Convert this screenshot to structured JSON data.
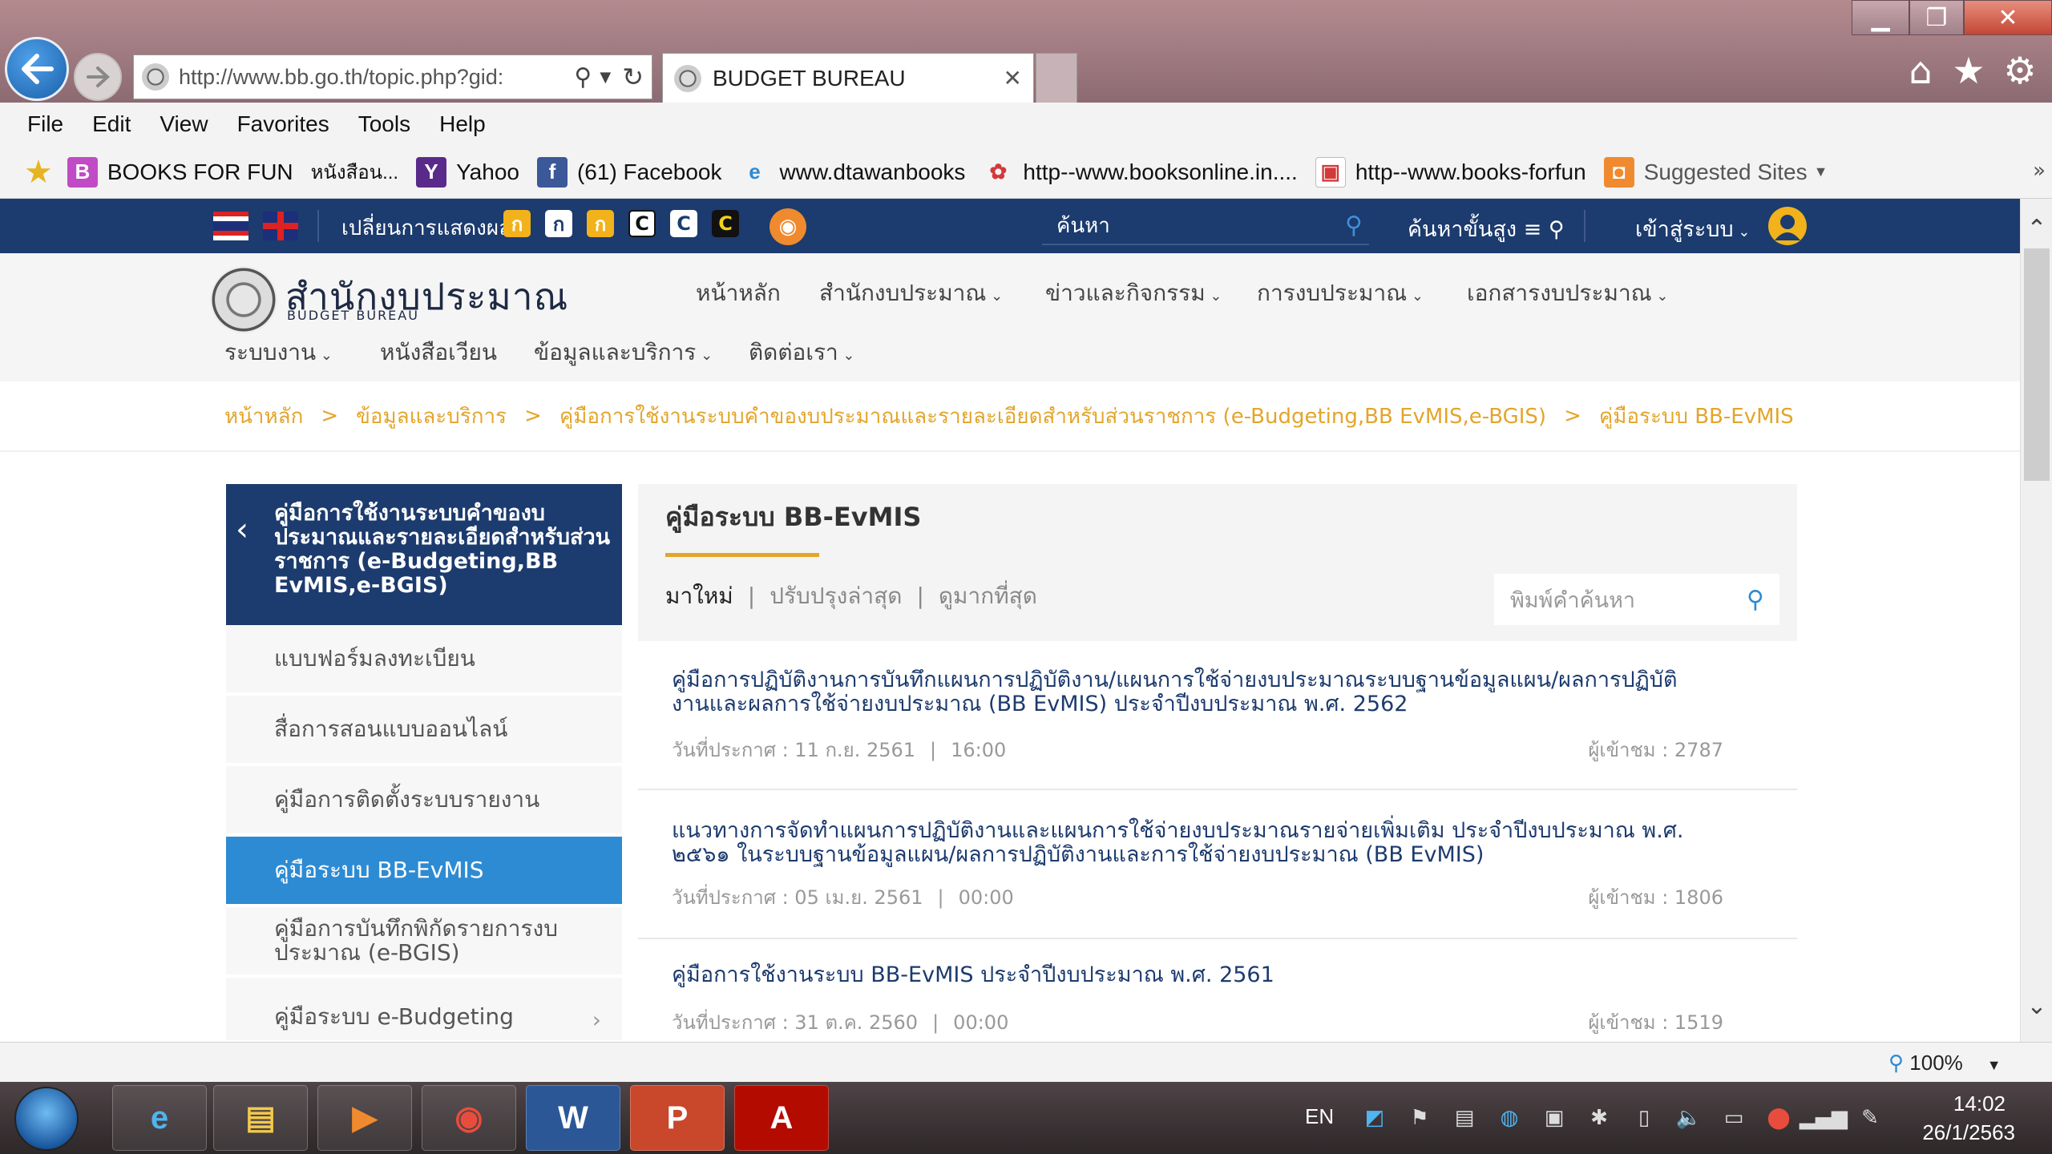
{
  "browser": {
    "url": "http://www.bb.go.th/topic.php?gid:",
    "tab_title": "BUDGET BUREAU",
    "menu": [
      "File",
      "Edit",
      "View",
      "Favorites",
      "Tools",
      "Help"
    ],
    "favorites": [
      {
        "label": "BOOKS FOR FUN",
        "icon": "B"
      },
      {
        "label": "หนังสือน...",
        "icon": ""
      },
      {
        "label": "Yahoo",
        "icon": "Y"
      },
      {
        "label": "(61) Facebook",
        "icon": "f"
      },
      {
        "label": "www.dtawanbooks",
        "icon": "e"
      },
      {
        "label": "http--www.booksonline.in....",
        "icon": "✿"
      },
      {
        "label": "http--www.books-forfun",
        "icon": "▣"
      },
      {
        "label": "Suggested Sites",
        "icon": "◘"
      }
    ],
    "zoom": "100%"
  },
  "site": {
    "topbar": {
      "display_label": "เปลี่ยนการแสดงผล",
      "display_buttons": [
        "ก",
        "ก",
        "ก",
        "C",
        "C",
        "C"
      ],
      "search_placeholder": "ค้นหา",
      "advanced_search": "ค้นหาขั้นสูง ≡",
      "login": "เข้าสู่ระบบ"
    },
    "logo": {
      "thai": "สำนักงบประมาณ",
      "english": "BUDGET BUREAU"
    },
    "nav_row1": [
      "หน้าหลัก",
      "สำนักงบประมาณ",
      "ข่าวและกิจกรรม",
      "การงบประมาณ",
      "เอกสารงบประมาณ"
    ],
    "nav_row2": [
      "ระบบงาน",
      "หนังสือเวียน",
      "ข้อมูลและบริการ",
      "ติดต่อเรา"
    ],
    "breadcrumb": [
      "หน้าหลัก",
      "ข้อมูลและบริการ",
      "คู่มือการใช้งานระบบคำของบประมาณและรายละเอียดสำหรับส่วนราชการ (e-Budgeting,BB EvMIS,e-BGIS)",
      "คู่มือระบบ BB-EvMIS"
    ],
    "sidebar": {
      "title": "คู่มือการใช้งานระบบคำของบประมาณและรายละเอียดสำหรับส่วนราชการ (e-Budgeting,BB EvMIS,e-BGIS)",
      "items": [
        {
          "label": "แบบฟอร์มลงทะเบียน"
        },
        {
          "label": "สื่อการสอนแบบออนไลน์"
        },
        {
          "label": "คู่มือการติดตั้งระบบรายงาน"
        },
        {
          "label": "คู่มือระบบ BB-EvMIS",
          "active": true
        },
        {
          "label": "คู่มือการบันทึกพิกัดรายการงบประมาณ (e-BGIS)"
        },
        {
          "label": "คู่มือระบบ e-Budgeting"
        }
      ]
    },
    "panel": {
      "title": "คู่มือระบบ BB-EvMIS",
      "sort_tabs": [
        "มาใหม่",
        "ปรับปรุงล่าสุด",
        "ดูมากที่สุด"
      ],
      "search_placeholder": "พิมพ์คำค้นหา"
    },
    "documents": [
      {
        "title": "คู่มือการปฏิบัติงานการบันทึกแผนการปฏิบัติงาน/แผนการใช้จ่ายงบประมาณระบบฐานข้อมูลแผน/ผลการปฏิบัติงานและผลการใช้จ่ายงบประมาณ (BB EvMIS) ประจำปีงบประมาณ พ.ศ. 2562",
        "date_label": "วันที่ประกาศ : 11 ก.ย. 2561",
        "time": "16:00",
        "views": "ผู้เข้าชม : 2787"
      },
      {
        "title": "แนวทางการจัดทำแผนการปฏิบัติงานและแผนการใช้จ่ายงบประมาณรายจ่ายเพิ่มเติม ประจำปีงบประมาณ พ.ศ. ๒๕๖๑ ในระบบฐานข้อมูลแผน/ผลการปฏิบัติงานและการใช้จ่ายงบประมาณ (BB EvMIS)",
        "date_label": "วันที่ประกาศ : 05 เม.ย. 2561",
        "time": "00:00",
        "views": "ผู้เข้าชม : 1806"
      },
      {
        "title": "คู่มือการใช้งานระบบ BB-EvMIS ประจำปีงบประมาณ พ.ศ. 2561",
        "date_label": "วันที่ประกาศ : 31 ต.ค. 2560",
        "time": "00:00",
        "views": "ผู้เข้าชม : 1519"
      }
    ]
  },
  "taskbar": {
    "apps": [
      "e",
      "▤",
      "▶",
      "◉",
      "W",
      "P",
      "A"
    ],
    "language": "EN",
    "time": "14:02",
    "date": "26/1/2563"
  }
}
